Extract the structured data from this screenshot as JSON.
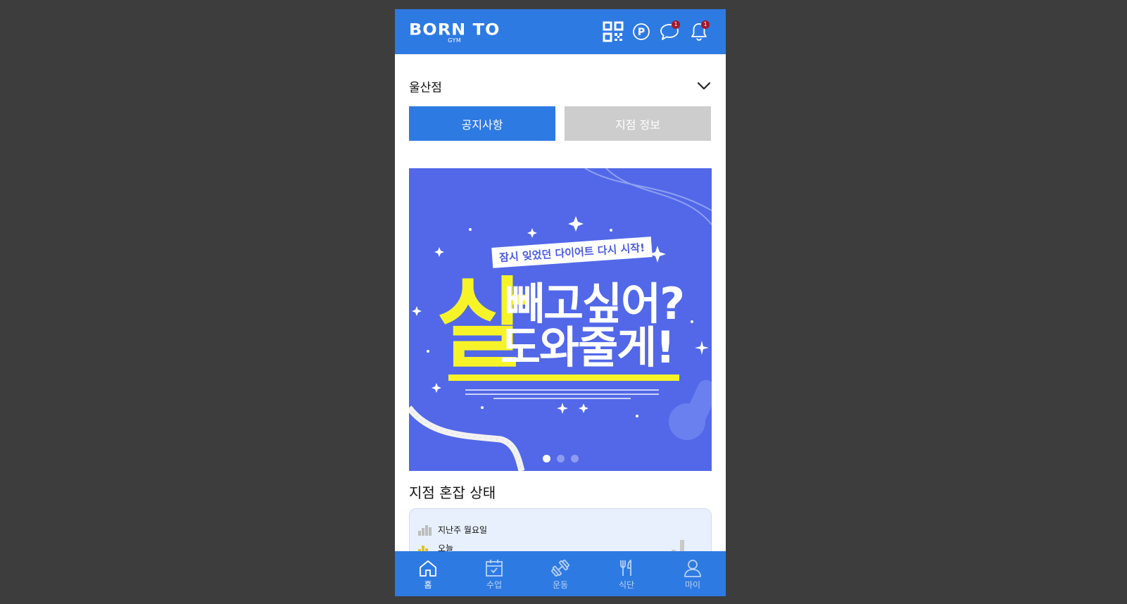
{
  "header": {
    "logo_main": "BORN TO",
    "logo_sub": "GYM",
    "point_label": "P",
    "message_badge": "1",
    "notification_badge": "1"
  },
  "branch": {
    "name": "울산점"
  },
  "tabs": [
    {
      "label": "공지사항",
      "active": true
    },
    {
      "label": "지점 정보",
      "active": false
    }
  ],
  "banner": {
    "subtitle": "잠시 잊었던 다이어트 다시 시작!",
    "big_char": "살",
    "line1": "빼고싶어?",
    "line2": "도와줄게!",
    "slide_count": 3,
    "active_slide": 0
  },
  "congestion": {
    "title": "지점 혼잡 상태",
    "legend": [
      {
        "label": "지난주 월요일",
        "color": "#bdbdbd"
      },
      {
        "label": "오늘",
        "color": "#e2c227"
      }
    ]
  },
  "bottom_nav": [
    {
      "label": "홈",
      "icon": "home-icon",
      "active": true
    },
    {
      "label": "수업",
      "icon": "calendar-icon",
      "active": false
    },
    {
      "label": "운동",
      "icon": "dumbbell-icon",
      "active": false
    },
    {
      "label": "식단",
      "icon": "fork-knife-icon",
      "active": false
    },
    {
      "label": "마이",
      "icon": "person-icon",
      "active": false
    }
  ],
  "colors": {
    "brand": "#2e7ae3",
    "badge": "#a3182a",
    "banner_bg": "#5268e8",
    "highlight": "#f6f428"
  }
}
